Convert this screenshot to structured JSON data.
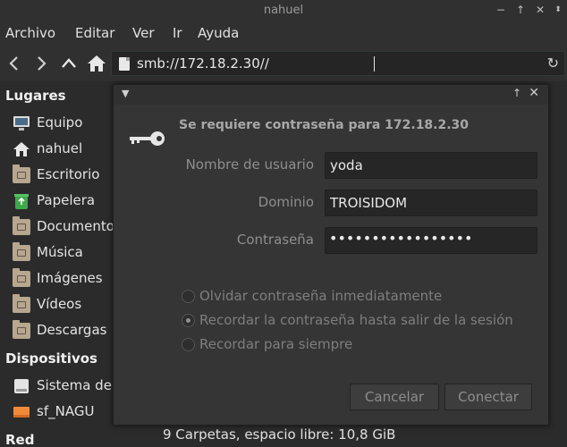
{
  "window": {
    "title": "nahuel"
  },
  "menubar": {
    "items": [
      "Archivo",
      "Editar",
      "Ver",
      "Ir",
      "Ayuda"
    ]
  },
  "toolbar": {
    "address": "smb://172.18.2.30//"
  },
  "sidebar": {
    "places_header": "Lugares",
    "places": [
      {
        "label": "Equipo",
        "icon": "computer-icon"
      },
      {
        "label": "nahuel",
        "icon": "home-icon"
      },
      {
        "label": "Escritorio",
        "icon": "desktop-folder-icon"
      },
      {
        "label": "Papelera",
        "icon": "trash-icon"
      },
      {
        "label": "Documentos",
        "icon": "documents-folder-icon"
      },
      {
        "label": "Música",
        "icon": "music-folder-icon"
      },
      {
        "label": "Imágenes",
        "icon": "pictures-folder-icon"
      },
      {
        "label": "Vídeos",
        "icon": "videos-folder-icon"
      },
      {
        "label": "Descargas",
        "icon": "downloads-folder-icon"
      }
    ],
    "devices_header": "Dispositivos",
    "devices": [
      {
        "label": "Sistema de archivos",
        "icon": "drive-icon"
      },
      {
        "label": "sf_NAGU",
        "icon": "shared-drive-icon"
      }
    ],
    "network_header": "Red"
  },
  "statusbar": {
    "text": "9 Carpetas, espacio libre: 10,8 GiB"
  },
  "dialog": {
    "heading": "Se requiere contraseña para 172.18.2.30",
    "username_label": "Nombre de usuario",
    "username_value": "yoda",
    "domain_label": "Dominio",
    "domain_value": "TROISIDOM",
    "password_label": "Contraseña",
    "password_value": "•••••••••••••••••",
    "options": [
      {
        "label": "Olvidar contraseña inmediatamente",
        "selected": false
      },
      {
        "label": "Recordar la contraseña hasta salir de la sesión",
        "selected": true
      },
      {
        "label": "Recordar para siempre",
        "selected": false
      }
    ],
    "cancel_label": "Cancelar",
    "connect_label": "Conectar"
  },
  "colors": {
    "background": "#2b2b2b",
    "dialog": "#353535",
    "folder": "#b7a78f",
    "trash": "#3fa84a",
    "drive": "#f08a3a"
  }
}
